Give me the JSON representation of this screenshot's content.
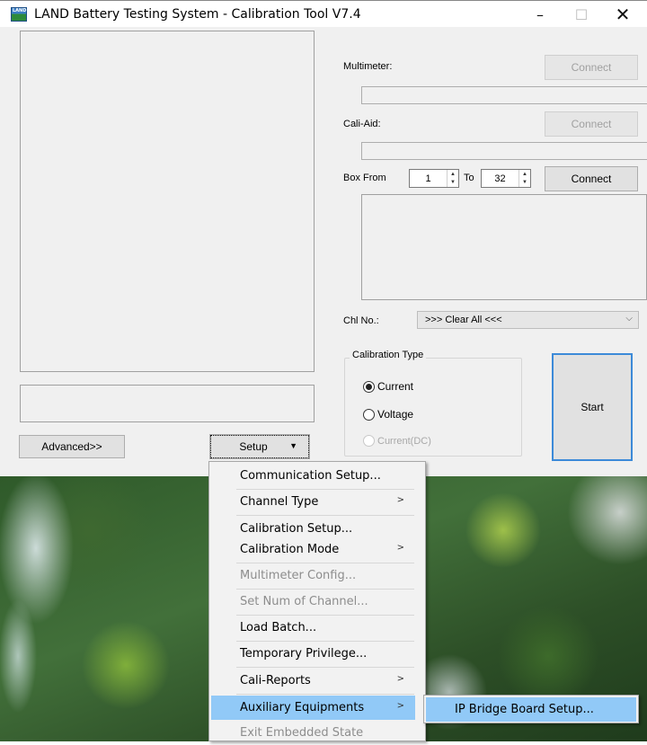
{
  "window": {
    "title": "LAND Battery Testing System - Calibration Tool V7.4",
    "app_icon": "LAND",
    "controls": {
      "minimize": "–",
      "maximize": "☐",
      "close": "✕"
    }
  },
  "left": {
    "advanced_button": "Advanced>>",
    "setup_button": "Setup"
  },
  "right": {
    "multimeter_label": "Multimeter:",
    "multimeter_connect": "Connect",
    "cali_aid_label": "Cali-Aid:",
    "cali_aid_connect": "Connect",
    "box_from_label": "Box From",
    "box_from_value": "1",
    "to_label": "To",
    "box_to_value": "32",
    "box_connect": "Connect",
    "chl_no_label": "Chl No.:",
    "chl_no_value": ">>> Clear All <<<",
    "calibration_type": {
      "title": "Calibration Type",
      "options": [
        "Current",
        "Voltage",
        "Current(DC)"
      ],
      "selected": "Current"
    },
    "start_button": "Start"
  },
  "setup_menu": {
    "items": [
      {
        "label": "Communication Setup...",
        "enabled": true,
        "submenu": false
      },
      {
        "label": "Channel Type",
        "enabled": true,
        "submenu": true
      },
      {
        "label": "Calibration Setup...",
        "enabled": true,
        "submenu": false
      },
      {
        "label": "Calibration Mode",
        "enabled": true,
        "submenu": true
      },
      {
        "label": "Multimeter Config...",
        "enabled": false,
        "submenu": false
      },
      {
        "label": "Set Num of Channel...",
        "enabled": false,
        "submenu": false
      },
      {
        "label": "Load Batch...",
        "enabled": true,
        "submenu": false
      },
      {
        "label": "Temporary Privilege...",
        "enabled": true,
        "submenu": false
      },
      {
        "label": "Cali-Reports",
        "enabled": true,
        "submenu": true
      },
      {
        "label": "Auxiliary Equipments",
        "enabled": true,
        "submenu": true,
        "highlighted": true
      },
      {
        "label": "Exit Embedded State",
        "enabled": false,
        "submenu": false
      }
    ]
  },
  "submenu": {
    "items": [
      {
        "label": "IP Bridge Board Setup...",
        "highlighted": true
      }
    ]
  },
  "colors": {
    "highlight": "#91c9f7",
    "dialog_bg": "#f0f0f0",
    "disabled_text": "#8d8d8d"
  }
}
